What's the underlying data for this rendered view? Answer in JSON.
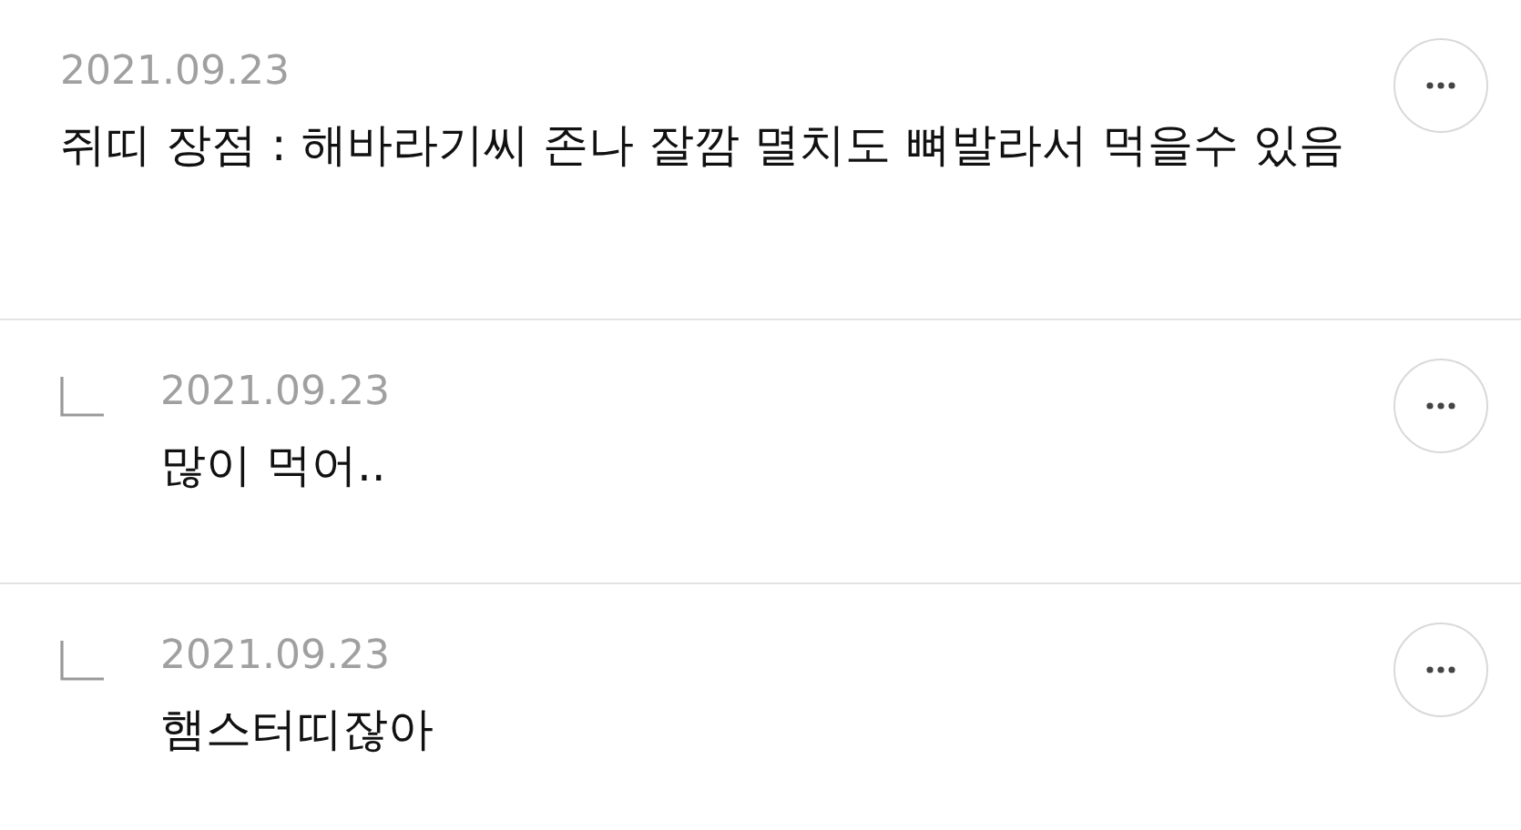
{
  "comments": [
    {
      "kind": "comment",
      "date": "2021.09.23",
      "text": "쥐띠 장점 : 해바라기씨 존나 잘깜 멸치도 뼈발라서 먹을수 있음"
    },
    {
      "kind": "reply",
      "date": "2021.09.23",
      "text": "많이 먹어.."
    },
    {
      "kind": "reply",
      "date": "2021.09.23",
      "text": "햄스터띠잖아"
    }
  ]
}
